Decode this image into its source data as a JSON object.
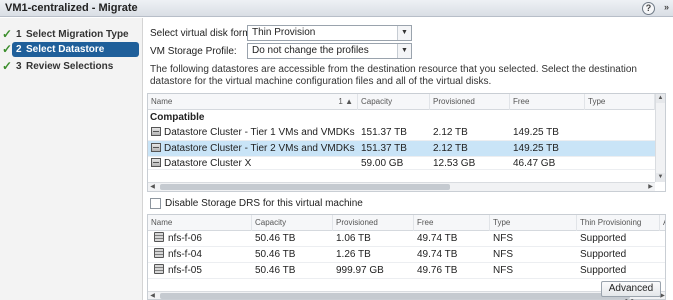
{
  "window": {
    "title": "VM1-centralized - Migrate"
  },
  "sidebar": {
    "steps": [
      {
        "num": "1",
        "label": "Select Migration Type"
      },
      {
        "num": "2",
        "label": "Select Datastore"
      },
      {
        "num": "3",
        "label": "Review Selections"
      }
    ]
  },
  "form": {
    "disk_format_label": "Select virtual disk format:",
    "disk_format_value": "Thin Provision",
    "storage_profile_label": "VM Storage Profile:",
    "storage_profile_value": "Do not change the profiles"
  },
  "description": "The following datastores are accessible from the destination resource that you selected. Select the destination datastore for the virtual machine configuration files and all of the virtual disks.",
  "datastore_table": {
    "columns": [
      "Name",
      "Capacity",
      "Provisioned",
      "Free",
      "Type"
    ],
    "sort_indicator": "1 ▲",
    "group_label": "Compatible",
    "rows": [
      {
        "name": "Datastore Cluster - Tier 1 VMs and VMDKs",
        "capacity": "151.37 TB",
        "provisioned": "2.12 TB",
        "free": "149.25 TB",
        "type": ""
      },
      {
        "name": "Datastore Cluster - Tier 2 VMs and VMDKs",
        "capacity": "151.37 TB",
        "provisioned": "2.12 TB",
        "free": "149.25 TB",
        "type": ""
      },
      {
        "name": "Datastore Cluster X",
        "capacity": "59.00 GB",
        "provisioned": "12.53 GB",
        "free": "46.47 GB",
        "type": ""
      }
    ]
  },
  "disable_drs_label": "Disable Storage DRS for this virtual machine",
  "member_table": {
    "columns": [
      "Name",
      "Capacity",
      "Provisioned",
      "Free",
      "Type",
      "Thin Provisioning"
    ],
    "rows": [
      {
        "name": "nfs-f-06",
        "capacity": "50.46 TB",
        "provisioned": "1.06 TB",
        "free": "49.74 TB",
        "type": "NFS",
        "thin": "Supported"
      },
      {
        "name": "nfs-f-04",
        "capacity": "50.46 TB",
        "provisioned": "1.26 TB",
        "free": "49.74 TB",
        "type": "NFS",
        "thin": "Supported"
      },
      {
        "name": "nfs-f-05",
        "capacity": "50.46 TB",
        "provisioned": "999.97 GB",
        "free": "49.76 TB",
        "type": "NFS",
        "thin": "Supported"
      }
    ]
  },
  "buttons": {
    "advanced": "Advanced >>"
  }
}
